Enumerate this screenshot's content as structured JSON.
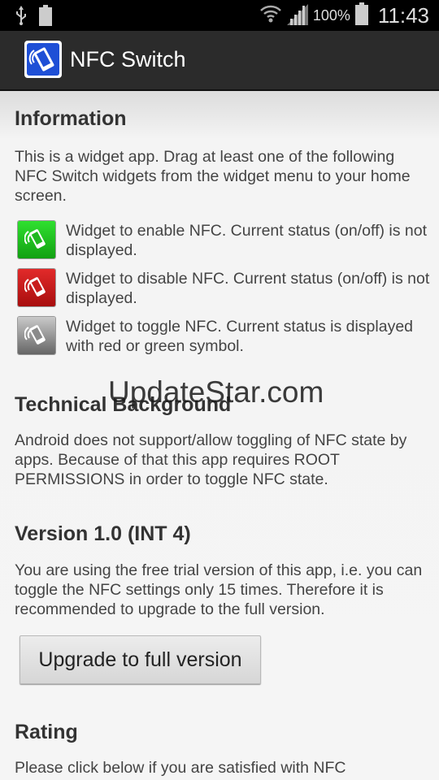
{
  "status_bar": {
    "battery_percent": "100%",
    "time": "11:43",
    "icons": [
      "usb-icon",
      "battery-small-icon",
      "wifi-icon",
      "signal-icon",
      "battery-icon"
    ]
  },
  "action_bar": {
    "title": "NFC Switch",
    "icon": "nfc-app-icon"
  },
  "sections": {
    "information": {
      "title": "Information",
      "body": "This is a widget app. Drag at least one of the following NFC Switch widgets from the widget menu to your home screen.",
      "widgets": [
        {
          "icon": "nfc-enable-widget-icon",
          "color": "#1fb81f",
          "text": "Widget to enable NFC. Current status (on/off) is not displayed."
        },
        {
          "icon": "nfc-disable-widget-icon",
          "color": "#c81d1d",
          "text": "Widget to disable NFC. Current status (on/off) is not displayed."
        },
        {
          "icon": "nfc-toggle-widget-icon",
          "color": "#8a8a8a",
          "text": "Widget to toggle NFC. Current status is displayed with red or green symbol."
        }
      ]
    },
    "technical": {
      "title": "Technical Background",
      "body": "Android does not support/allow toggling of NFC state by apps. Because of that this app requires ROOT PERMISSIONS in order to toggle NFC state."
    },
    "version": {
      "title": "Version 1.0 (INT 4)",
      "body": "You are using the free trial version of this app, i.e. you can toggle the NFC settings only 15 times. Therefore it is recommended to upgrade to the full version.",
      "button_label": "Upgrade to full version"
    },
    "rating": {
      "title": "Rating",
      "body_partial": "Please click below if you are satisfied with NFC"
    }
  },
  "watermark": "UpdateStar.com"
}
